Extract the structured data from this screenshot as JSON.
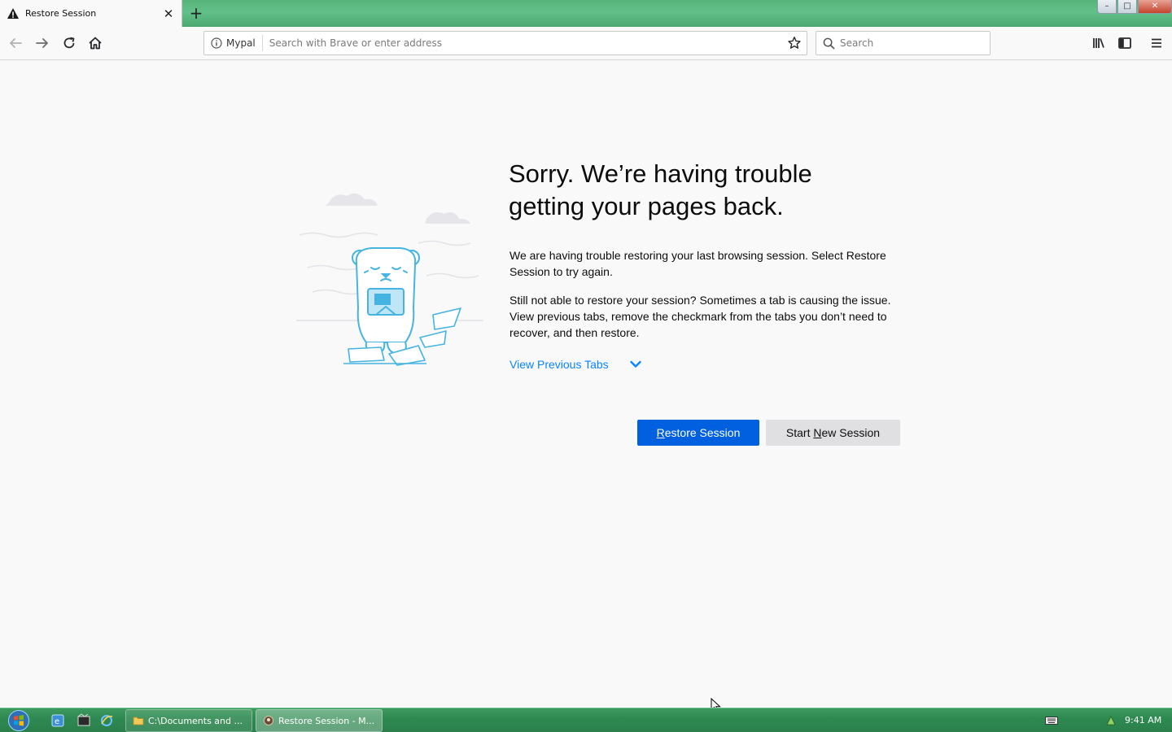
{
  "browser": {
    "tab": {
      "title": "Restore Session"
    },
    "window_controls": {
      "minimize": "–",
      "maximize": "□",
      "close": "✕"
    },
    "urlbar": {
      "identity_label": "Mypal",
      "placeholder": "Search with Brave or enter address",
      "value": ""
    },
    "searchbar": {
      "placeholder": "Search",
      "value": ""
    }
  },
  "icons": {
    "tab": [
      "warning-icon",
      "close-icon",
      "plus-icon"
    ],
    "nav": [
      "back-arrow-icon",
      "forward-arrow-icon",
      "reload-icon",
      "home-icon",
      "info-icon",
      "star-icon",
      "search-icon",
      "library-icon",
      "sidebar-icon",
      "hamburger-menu-icon"
    ],
    "content": [
      "chevron-down-icon"
    ],
    "taskbar": [
      "windows-start-icon",
      "folder-icon",
      "browser-icon",
      "keyboard-icon",
      "network-icon"
    ]
  },
  "page": {
    "title_line1": "Sorry. We’re having trouble",
    "title_line2": "getting your pages back.",
    "para1": "We are having trouble restoring your last browsing session. Select Restore Session to try again.",
    "para2": "Still not able to restore your session? Sometimes a tab is causing the issue. View previous tabs, remove the checkmark from the tabs you don’t need to recover, and then restore.",
    "view_previous_tabs": "View Previous Tabs",
    "buttons": {
      "restore_pre": "",
      "restore_key": "R",
      "restore_post": "estore Session",
      "new_pre": "Start ",
      "new_key": "N",
      "new_post": "ew Session"
    }
  },
  "taskbar": {
    "items": [
      {
        "label": "C:\\Documents and ..."
      },
      {
        "label": "Restore Session - M..."
      }
    ],
    "clock": "9:41 AM"
  },
  "colors": {
    "accent": "#0060df",
    "link": "#0a84ff",
    "page_bg": "#f9f9fa",
    "taskbar": "#2f8a52",
    "illustration": "#45b4e0"
  }
}
